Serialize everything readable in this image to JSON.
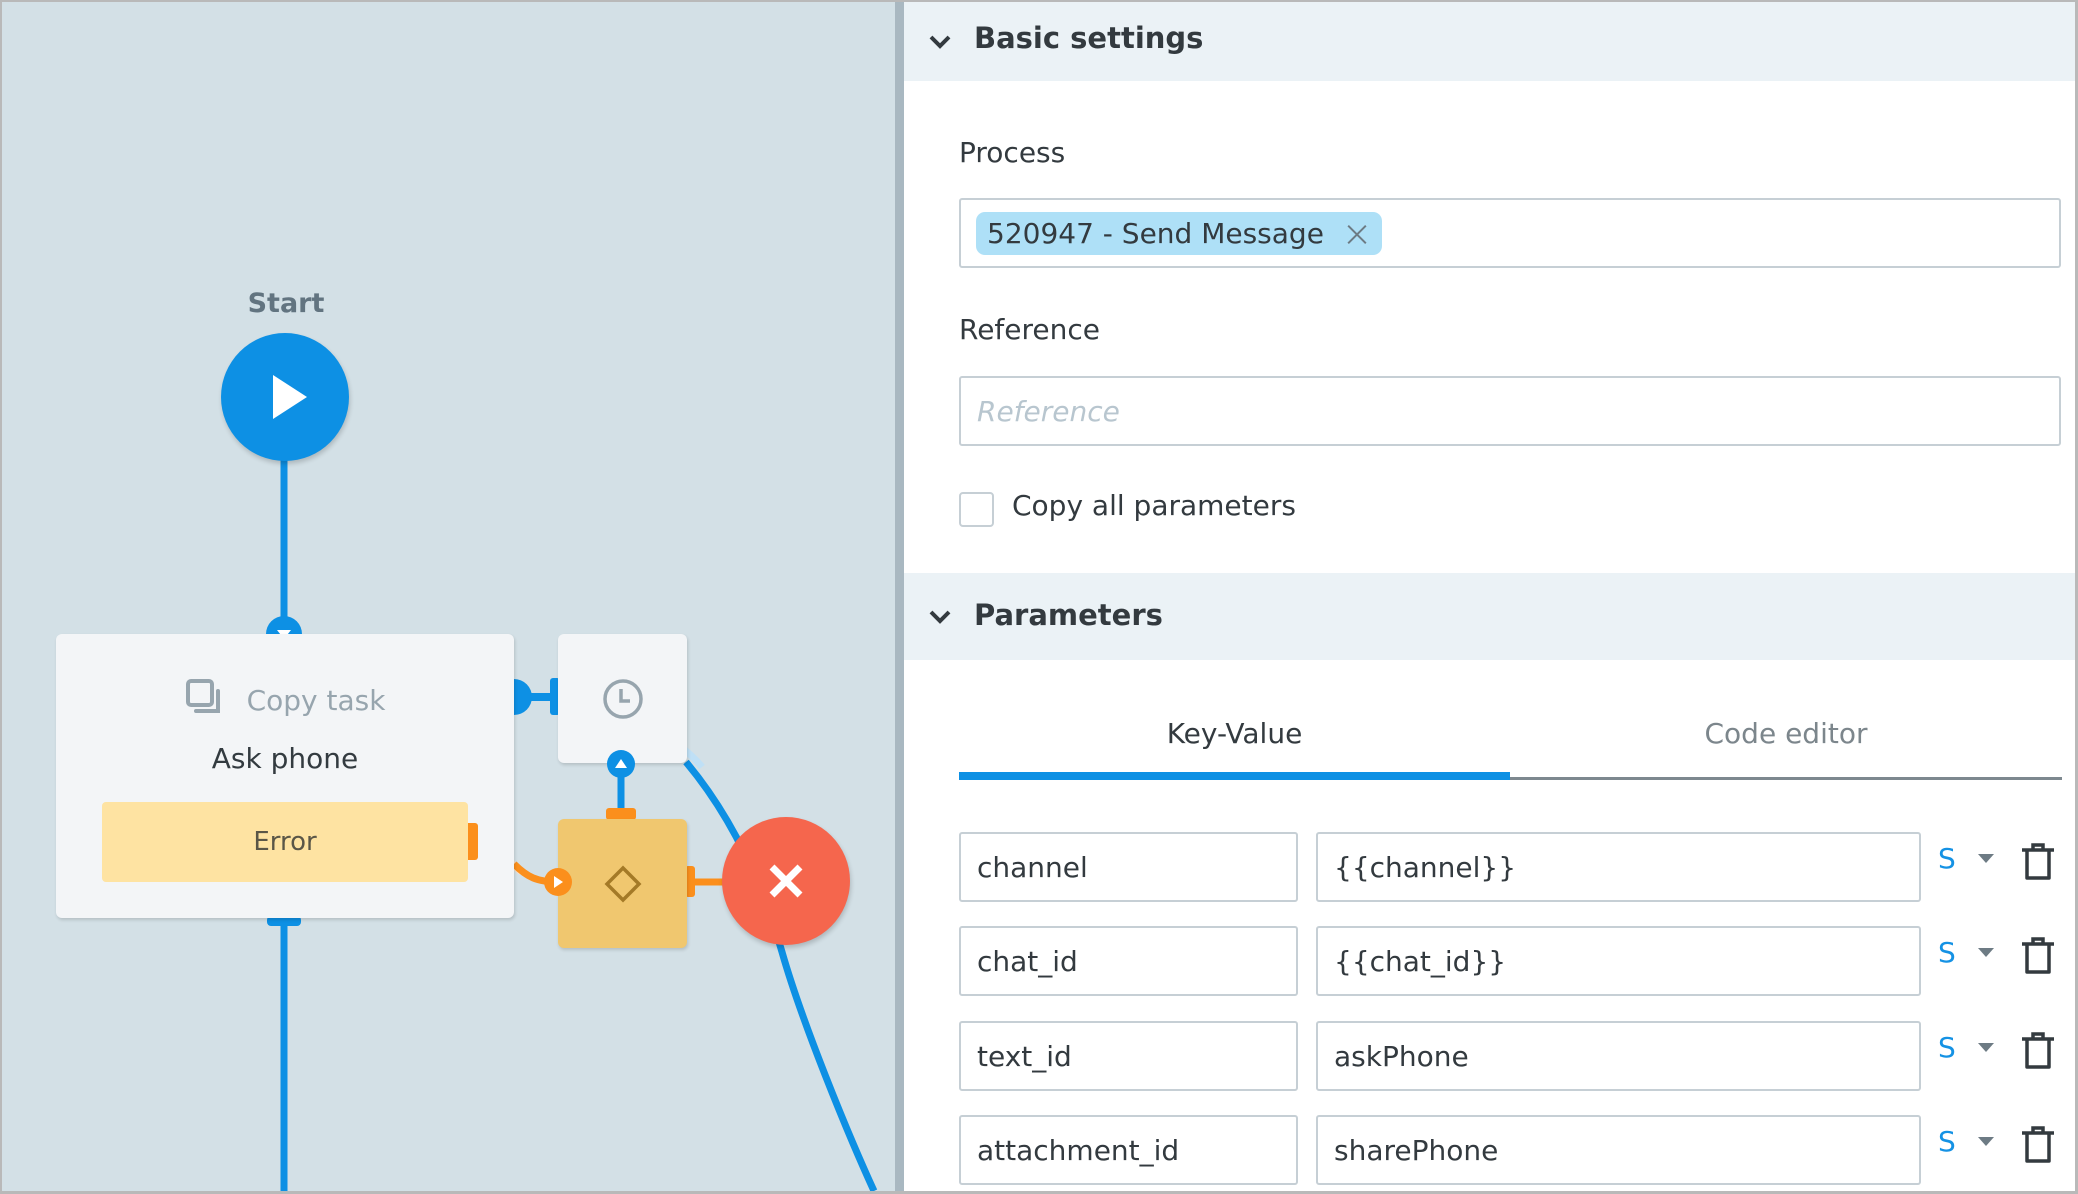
{
  "canvas": {
    "start": {
      "label": "Start"
    },
    "task_node": {
      "type_label": "Copy task",
      "title": "Ask phone",
      "error_label": "Error"
    },
    "icons": {
      "start": "play-icon",
      "task_type": "copy-icon",
      "timer": "clock-icon",
      "gateway": "diamond-icon",
      "end": "close-icon"
    },
    "colors": {
      "background": "#d3e0e6",
      "flow_blue": "#0d90e4",
      "error_orange": "#fb8f1c",
      "gateway_yellow": "#f0c76f",
      "end_red": "#f5664d",
      "error_fill": "#fee3a2"
    }
  },
  "panel": {
    "basic_settings": {
      "title": "Basic settings",
      "process": {
        "label": "Process",
        "selected_tag": "520947 - Send Message"
      },
      "reference": {
        "label": "Reference",
        "value": "",
        "placeholder": "Reference"
      },
      "copy_all": {
        "label": "Copy all parameters",
        "checked": false
      }
    },
    "parameters": {
      "title": "Parameters",
      "tabs": [
        {
          "label": "Key-Value",
          "active": true
        },
        {
          "label": "Code editor",
          "active": false
        }
      ],
      "rows": [
        {
          "key": "channel",
          "value": "{{channel}}",
          "type": "S"
        },
        {
          "key": "chat_id",
          "value": "{{chat_id}}",
          "type": "S"
        },
        {
          "key": "text_id",
          "value": "askPhone",
          "type": "S"
        },
        {
          "key": "attachment_id",
          "value": "sharePhone",
          "type": "S"
        }
      ]
    }
  }
}
